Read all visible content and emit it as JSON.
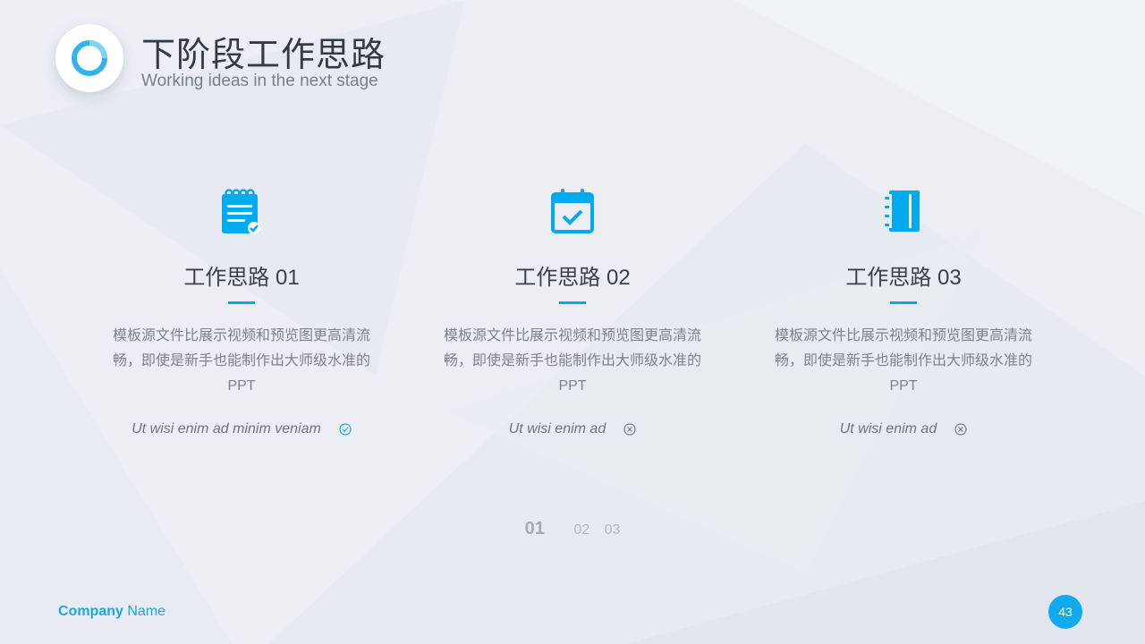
{
  "header": {
    "title": "下阶段工作思路",
    "subtitle": "Working ideas in the next stage",
    "logo_icon": "ring-icon"
  },
  "colors": {
    "accent": "#00aaee",
    "title_text": "#333a44",
    "body_text": "#7d828b",
    "background": "#eceef4"
  },
  "columns": [
    {
      "icon": "clipboard-check-icon",
      "heading": "工作思路 01",
      "description": "模板源文件比展示视频和预览图更高清流畅，即使是新手也能制作出大师级水准的PPT",
      "note": "Ut wisi enim ad minim veniam",
      "status_icon": "check-circle-icon"
    },
    {
      "icon": "calendar-check-icon",
      "heading": "工作思路 02",
      "description": "模板源文件比展示视频和预览图更高清流畅，即使是新手也能制作出大师级水准的PPT",
      "note": "Ut wisi enim ad",
      "status_icon": "close-circle-icon"
    },
    {
      "icon": "notebook-icon",
      "heading": "工作思路 03",
      "description": "模板源文件比展示视频和预览图更高清流畅，即使是新手也能制作出大师级水准的PPT",
      "note": "Ut wisi enim ad",
      "status_icon": "close-circle-icon"
    }
  ],
  "pager": {
    "items": [
      "01",
      "02",
      "03"
    ],
    "active": "01"
  },
  "footer": {
    "company_bold": "Company",
    "company_rest": "Name",
    "page_number": "43"
  }
}
